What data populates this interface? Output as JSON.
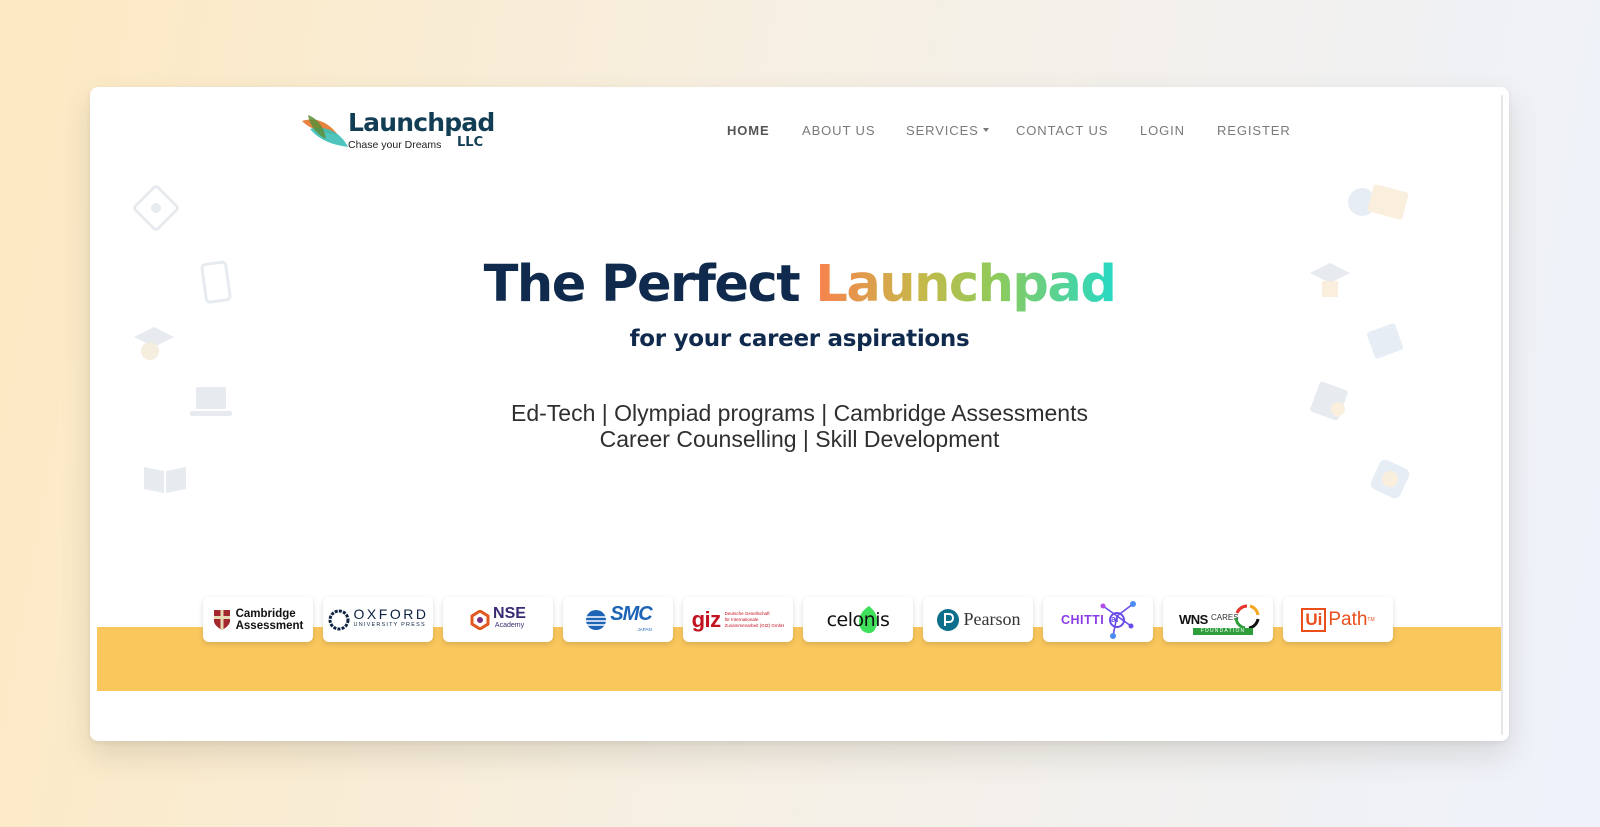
{
  "brand": {
    "name": "Launchpad",
    "tagline": "Chase your Dreams",
    "suffix": "LLC"
  },
  "nav": {
    "home": "HOME",
    "about": "ABOUT US",
    "services": "SERVICES",
    "contact": "CONTACT US",
    "login": "LOGIN",
    "register": "REGISTER"
  },
  "hero": {
    "title_main": "The Perfect ",
    "title_accent": "Launchpad",
    "subtitle": "for your career aspirations",
    "line1": "Ed-Tech | Olympiad programs | Cambridge Assessments",
    "line2": "Career Counselling | Skill Development"
  },
  "partners": {
    "cambridge": [
      "Cambridge",
      "Assessment"
    ],
    "oxford": [
      "OXFORD",
      "UNIVERSITY PRESS"
    ],
    "nse": [
      "NSE",
      "Academy"
    ],
    "smc": [
      "SMC",
      "JAPAN"
    ],
    "giz": [
      "giz",
      "Deutsche Gesellschaft",
      "für Internationale",
      "Zusammenarbeit (GIZ) GmbH"
    ],
    "celonis": "celonis",
    "pearson": "Pearson",
    "chitti": [
      "CHITTI",
      "ai"
    ],
    "wns": [
      "WNS",
      "CARES",
      "FOUNDATION"
    ],
    "uipath": [
      "Ui",
      "Path",
      "TM"
    ]
  },
  "colors": {
    "navy": "#0f2a4d",
    "band": "#fac75d",
    "accent_gradient": [
      "#f7824e",
      "#c7b84a",
      "#8fcb5a",
      "#27d9c5"
    ]
  }
}
